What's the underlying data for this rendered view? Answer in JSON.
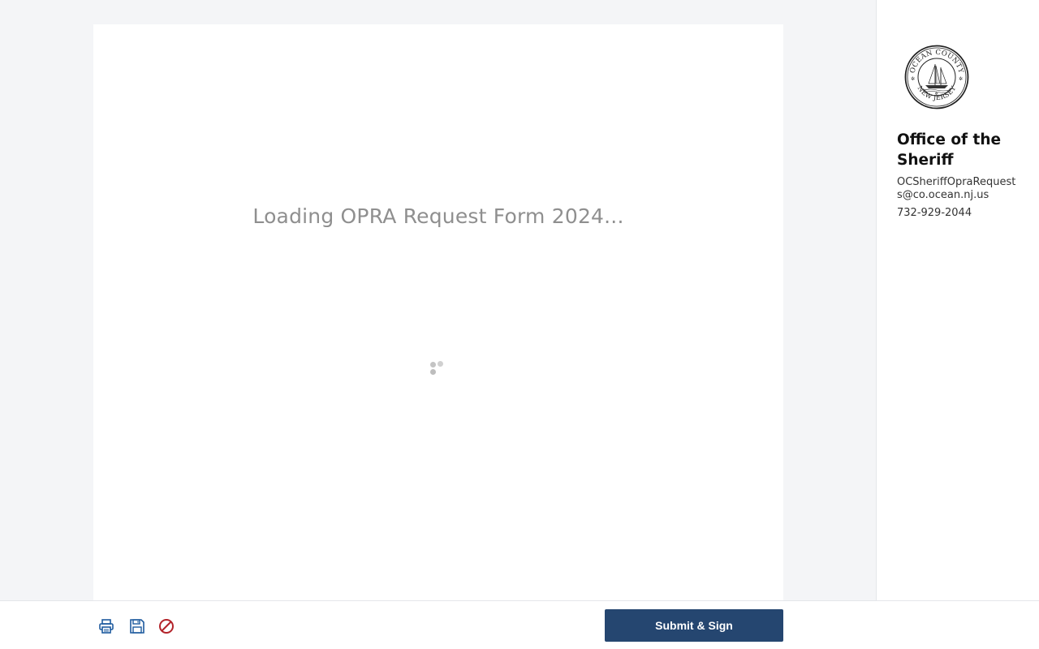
{
  "form": {
    "loading_text": "Loading OPRA Request Form 2024..."
  },
  "sidebar": {
    "seal_icon": "ocean-county-new-jersey-seal",
    "seal_text_top": "OCEAN COUNTY",
    "seal_text_bottom": "NEW JERSEY",
    "office_title": "Office of the Sheriff",
    "email": "OCSheriffOpraRequests@co.ocean.nj.us",
    "phone": "732-929-2044"
  },
  "footer": {
    "print_icon": "printer-icon",
    "save_icon": "floppy-disk-icon",
    "cancel_icon": "prohibited-icon",
    "submit_label": "Submit & Sign"
  },
  "colors": {
    "accent": "#254670",
    "icon_blue": "#1d5a9e",
    "cancel_red": "#b3242b",
    "background": "#f4f5f7"
  }
}
